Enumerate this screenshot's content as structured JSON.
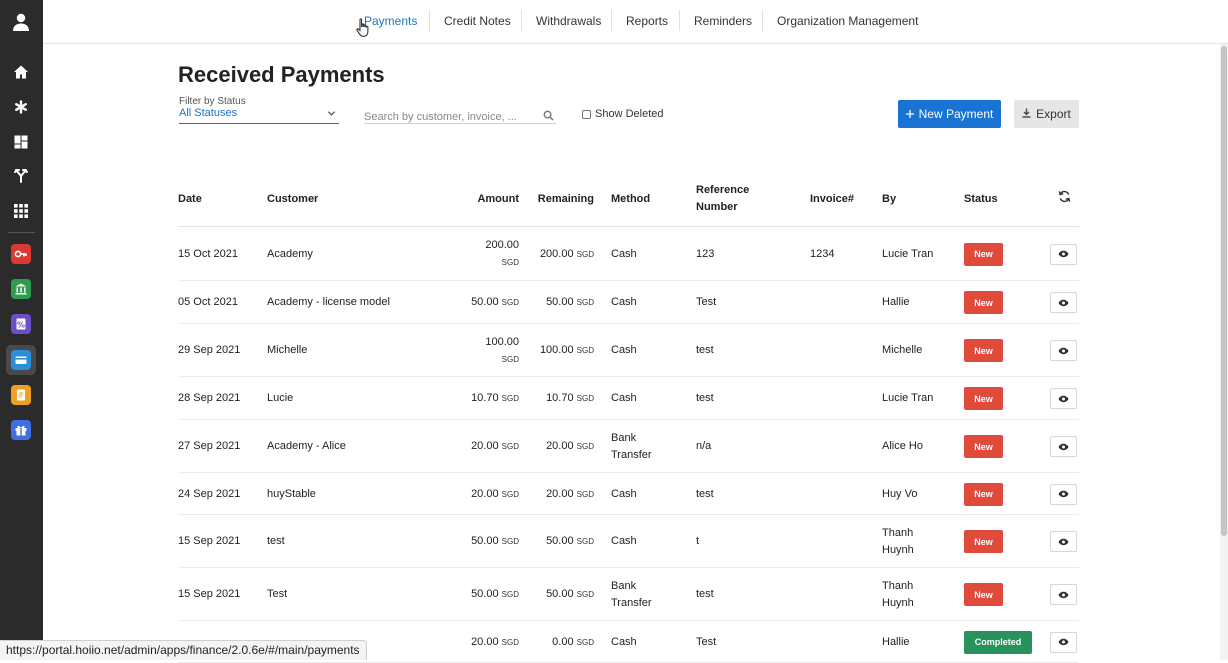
{
  "sidebar": {
    "icons": [
      "user-avatar-icon",
      "home-icon",
      "asterisk-icon",
      "dashboard-icon",
      "branch-icon",
      "apps-grid-icon"
    ],
    "apps": [
      {
        "name": "key-app-icon",
        "color": "#d83a34"
      },
      {
        "name": "bank-app-icon",
        "color": "#2e9e4e"
      },
      {
        "name": "voucher-app-icon",
        "color": "#6a4fc8"
      },
      {
        "name": "finance-app-icon",
        "color": "#2b8fd8"
      },
      {
        "name": "notes-app-icon",
        "color": "#f0a020"
      },
      {
        "name": "gift-app-icon",
        "color": "#3f6fe0"
      }
    ]
  },
  "topnav": {
    "tabs": [
      "Payments",
      "Credit Notes",
      "Withdrawals",
      "Reports",
      "Reminders",
      "Organization Management"
    ],
    "active": "Payments"
  },
  "page": {
    "title": "Received Payments",
    "filter_label": "Filter by Status",
    "filter_value": "All Statuses",
    "search_placeholder": "Search by customer, invoice, ...",
    "show_deleted_label": "Show Deleted",
    "new_payment_label": "New Payment",
    "export_label": "Export"
  },
  "table": {
    "columns": {
      "date": "Date",
      "customer": "Customer",
      "amount": "Amount",
      "remaining": "Remaining",
      "method": "Method",
      "reference_l1": "Reference",
      "reference_l2": "Number",
      "invoice": "Invoice#",
      "by": "By",
      "status": "Status"
    },
    "currency": "SGD",
    "rows": [
      {
        "date": "15 Oct 2021",
        "customer": "Academy",
        "amount": "200.00",
        "remaining": "200.00",
        "method": "Cash",
        "method2": "",
        "reference": "123",
        "invoice": "1234",
        "by": "Lucie Tran",
        "by2": "",
        "status": "New"
      },
      {
        "date": "05 Oct 2021",
        "customer": "Academy - license model",
        "amount": "50.00",
        "remaining": "50.00",
        "method": "Cash",
        "method2": "",
        "reference": "Test",
        "invoice": "",
        "by": "Hallie",
        "by2": "",
        "status": "New"
      },
      {
        "date": "29 Sep 2021",
        "customer": "Michelle",
        "amount": "100.00",
        "remaining": "100.00",
        "method": "Cash",
        "method2": "",
        "reference": "test",
        "invoice": "",
        "by": "Michelle",
        "by2": "",
        "status": "New"
      },
      {
        "date": "28 Sep 2021",
        "customer": "Lucie",
        "amount": "10.70",
        "remaining": "10.70",
        "method": "Cash",
        "method2": "",
        "reference": "test",
        "invoice": "",
        "by": "Lucie Tran",
        "by2": "",
        "status": "New"
      },
      {
        "date": "27 Sep 2021",
        "customer": "Academy - Alice",
        "amount": "20.00",
        "remaining": "20.00",
        "method": "Bank",
        "method2": "Transfer",
        "reference": "n/a",
        "invoice": "",
        "by": "Alice Ho",
        "by2": "",
        "status": "New"
      },
      {
        "date": "24 Sep 2021",
        "customer": "huyStable",
        "amount": "20.00",
        "remaining": "20.00",
        "method": "Cash",
        "method2": "",
        "reference": "test",
        "invoice": "",
        "by": "Huy Vo",
        "by2": "",
        "status": "New"
      },
      {
        "date": "15 Sep 2021",
        "customer": "test",
        "amount": "50.00",
        "remaining": "50.00",
        "method": "Cash",
        "method2": "",
        "reference": "t",
        "invoice": "",
        "by": "Thanh",
        "by2": "Huynh",
        "status": "New"
      },
      {
        "date": "15 Sep 2021",
        "customer": "Test",
        "amount": "50.00",
        "remaining": "50.00",
        "method": "Bank",
        "method2": "Transfer",
        "reference": "test",
        "invoice": "",
        "by": "Thanh",
        "by2": "Huynh",
        "status": "New"
      },
      {
        "date": "",
        "customer": "",
        "amount": "20.00",
        "remaining": "0.00",
        "method": "Cash",
        "method2": "",
        "reference": "Test",
        "invoice": "",
        "by": "Hallie",
        "by2": "",
        "status": "Completed"
      }
    ]
  },
  "statusbar": {
    "url": "https://portal.hoiio.net/admin/apps/finance/2.0.6e/#/main/payments"
  },
  "colors": {
    "accent": "#1873d3",
    "status_new": "#e04a3a",
    "status_completed": "#27925b"
  }
}
